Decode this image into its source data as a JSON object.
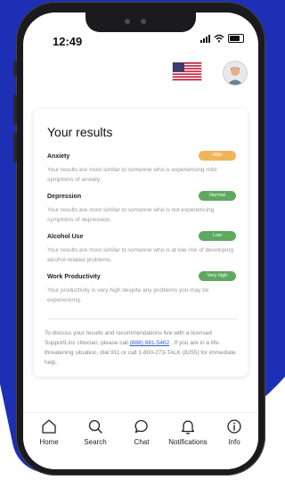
{
  "status_bar": {
    "time": "12:49"
  },
  "results": {
    "title": "Your results",
    "metrics": [
      {
        "name": "Anxiety",
        "badge": "Mild",
        "badge_color": "#f0b45b",
        "description": "Your results are most similar to someone who is experiencing mild symptoms of anxiety."
      },
      {
        "name": "Depression",
        "badge": "Normal",
        "badge_color": "#5fa860",
        "description": "Your results are most similar to someone who is not experiencing symptoms of depression."
      },
      {
        "name": "Alcohol Use",
        "badge": "Low",
        "badge_color": "#5fa860",
        "description": "Your results are most similar to someone who is at low risk of developing alcohol-related problems."
      },
      {
        "name": "Work Productivity",
        "badge": "Very high",
        "badge_color": "#5fa860",
        "description": "Your productivity is very high despite any problems you may be experiencing."
      }
    ],
    "footer_part1": "To discuss your results and recommendations live with a licensed SupportLinc clinician, please call ",
    "footer_phone": "(888) 881-5462",
    "footer_part2": " . If you are in a life-threatening situation, dial 911 or call 1-800-273-TALK (8255) for immediate help."
  },
  "tabs": [
    {
      "label": "Home",
      "icon": "home-icon"
    },
    {
      "label": "Search",
      "icon": "search-icon"
    },
    {
      "label": "Chat",
      "icon": "chat-icon"
    },
    {
      "label": "Notifications",
      "icon": "bell-icon"
    },
    {
      "label": "Info",
      "icon": "info-icon"
    }
  ],
  "colors": {
    "background_blue": "#1d2fb5",
    "link": "#2f5bd9"
  }
}
